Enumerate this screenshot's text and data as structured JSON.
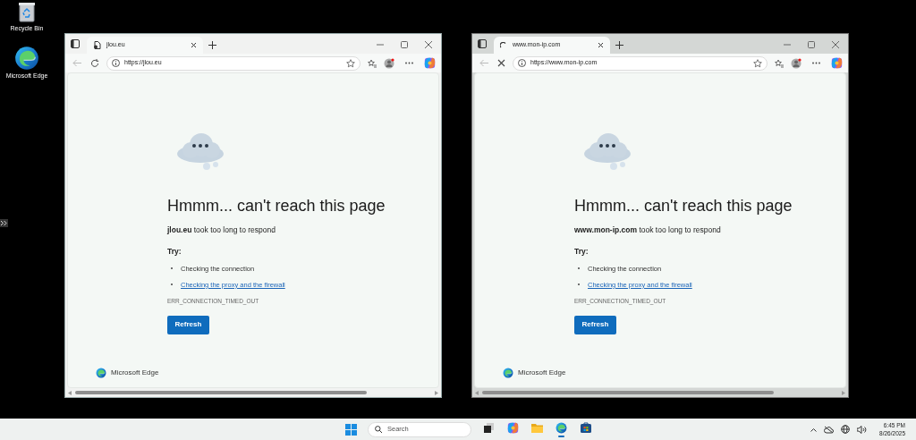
{
  "desktop_icons": [
    {
      "kind": "recycle",
      "label": "Recycle Bin"
    },
    {
      "kind": "edge",
      "label": "Microsoft Edge"
    }
  ],
  "windows": [
    {
      "focused": true,
      "loading": false,
      "tab_title": "jlou.eu",
      "url": "https://jlou.eu",
      "page": {
        "heading": "Hmmm... can't reach this page",
        "message": "**jlou.eu** took too long to respond",
        "try_label": "Try:",
        "suggestions": [
          {
            "kind": "text",
            "text": "Checking the connection"
          },
          {
            "kind": "link",
            "text": "Checking the proxy and the firewall"
          }
        ],
        "error_code": "ERR_CONNECTION_TIMED_OUT",
        "button": "Refresh",
        "brand": "Microsoft Edge"
      }
    },
    {
      "focused": false,
      "loading": true,
      "tab_title": "www.mon-ip.com",
      "url": "https://www.mon-ip.com",
      "page": {
        "heading": "Hmmm... can't reach this page",
        "message": "**www.mon-ip.com** took too long to respond",
        "try_label": "Try:",
        "suggestions": [
          {
            "kind": "text",
            "text": "Checking the connection"
          },
          {
            "kind": "link",
            "text": "Checking the proxy and the firewall"
          }
        ],
        "error_code": "ERR_CONNECTION_TIMED_OUT",
        "button": "Refresh",
        "brand": "Microsoft Edge"
      }
    }
  ],
  "taskbar": {
    "search_placeholder": "Search",
    "apps": [
      {
        "kind": "taskview",
        "active": false
      },
      {
        "kind": "copilot",
        "active": false
      },
      {
        "kind": "folder",
        "active": false
      },
      {
        "kind": "edge",
        "active": true
      },
      {
        "kind": "store",
        "active": false
      }
    ],
    "time": "6:45 PM",
    "date": "8/26/2025"
  }
}
